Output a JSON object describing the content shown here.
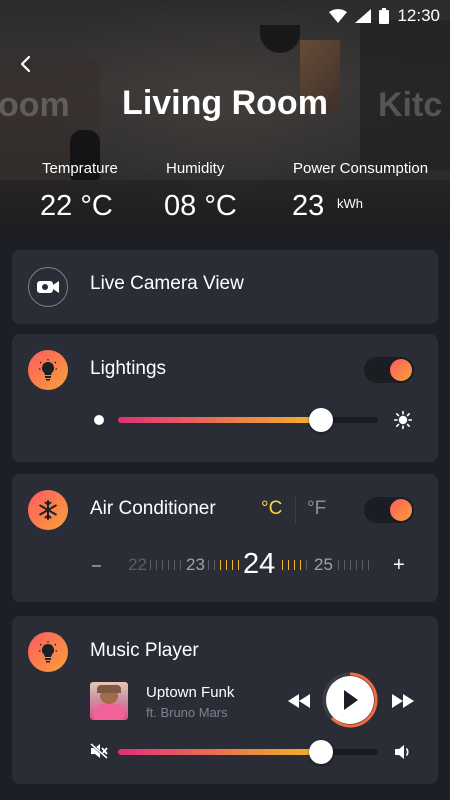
{
  "status_bar": {
    "time": "12:30"
  },
  "header": {
    "room_title": "Living Room",
    "prev_room_partial": "oom",
    "next_room_partial": "Kitc",
    "stats": [
      {
        "label": "Temprature",
        "value": "22 °C"
      },
      {
        "label": "Humidity",
        "value": "08 °C"
      },
      {
        "label": "Power Consumption",
        "value": "23",
        "unit": "kWh"
      }
    ]
  },
  "camera_card": {
    "title": "Live Camera View"
  },
  "lightings_card": {
    "title": "Lightings",
    "toggle_on": true,
    "brightness_fraction": 0.78
  },
  "ac_card": {
    "title": "Air Conditioner",
    "unit_c": "°C",
    "unit_f": "°F",
    "selected_unit": "°C",
    "toggle_on": true,
    "minus": "–",
    "plus": "+",
    "temps": [
      "22",
      "23",
      "24",
      "25"
    ],
    "current_temp": "24"
  },
  "music_card": {
    "title": "Music Player",
    "song_title": "Uptown Funk",
    "song_artist": "ft. Bruno Mars",
    "volume_fraction": 0.78,
    "playing": false
  },
  "colors": {
    "accent_start": "#ff5a5f",
    "accent_end": "#f7a23a",
    "slider_pink": "#e0307a",
    "slider_yellow": "#f2b52a",
    "ac_unit_active": "#f5d34b"
  },
  "icons": [
    "back-arrow-icon",
    "camera-icon",
    "bulb-icon",
    "snowflake-icon",
    "sun-icon",
    "rewind-icon",
    "play-icon",
    "fast-forward-icon",
    "mute-icon",
    "volume-icon",
    "wifi-icon",
    "signal-icon",
    "battery-icon"
  ]
}
